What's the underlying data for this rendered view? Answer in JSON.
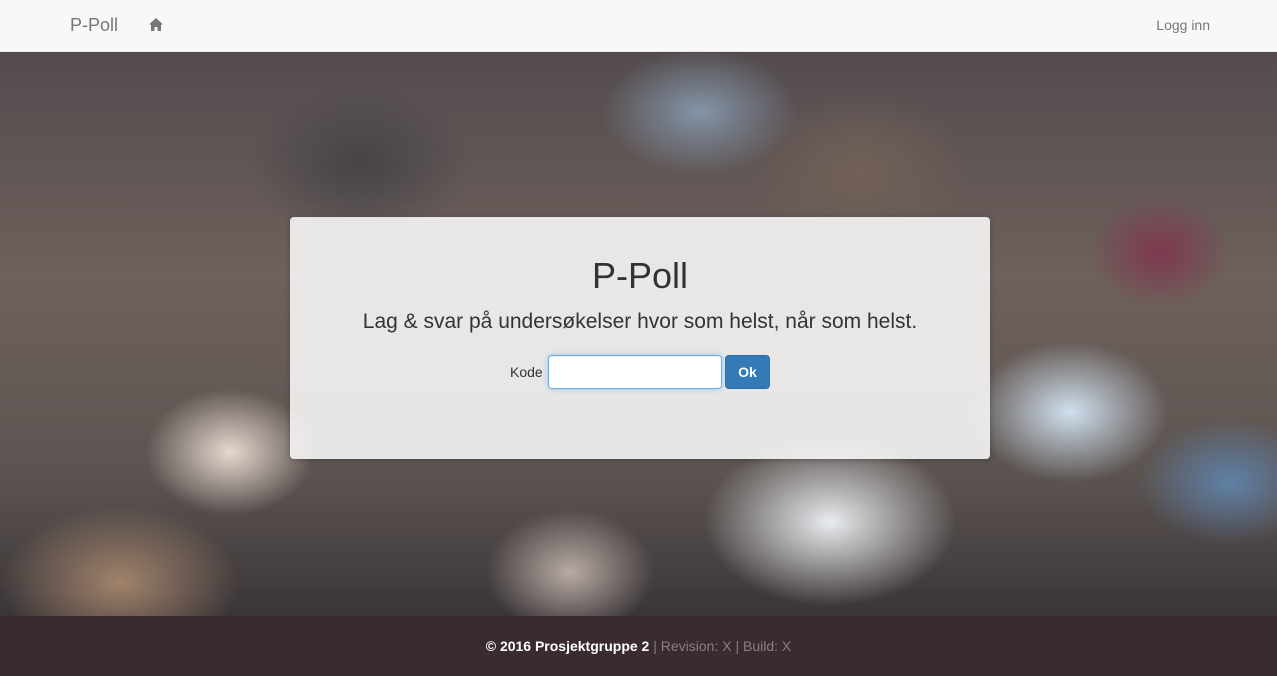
{
  "navbar": {
    "brand": "P-Poll",
    "home_icon": "home-icon",
    "login_label": "Logg inn"
  },
  "hero": {
    "title": "P-Poll",
    "tagline": "Lag & svar på undersøkelser hvor som helst, når som helst.",
    "code_label": "Kode",
    "code_value": "",
    "code_placeholder": "",
    "ok_label": "Ok"
  },
  "footer": {
    "copyright": "© 2016 Prosjektgruppe 2",
    "separator": "|",
    "revision": "Revision: X",
    "build": "Build: X"
  },
  "colors": {
    "primary": "#337ab7",
    "footer_bg": "#3a2a31",
    "navbar_bg": "#f8f8f8"
  }
}
